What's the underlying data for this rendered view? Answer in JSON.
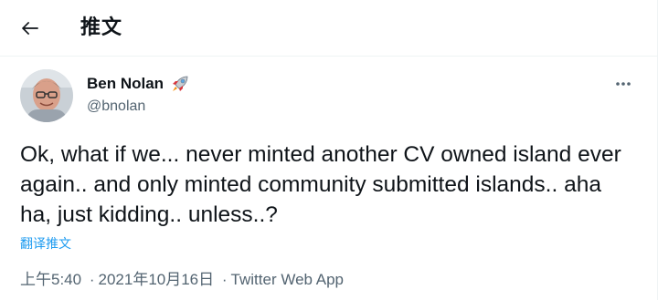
{
  "header": {
    "back_icon": "arrow-left-icon",
    "title": "推文"
  },
  "tweet": {
    "author": {
      "name": "Ben Nolan",
      "name_icon": "rocket-icon",
      "handle": "@bnolan"
    },
    "more_icon": "ellipsis-icon",
    "text": "Ok, what if we... never minted another CV owned island ever again.. and only minted community submitted islands.. aha ha, just kidding.. unless..?",
    "translate_label": "翻译推文",
    "time": "上午5:40",
    "date": "2021年10月16日",
    "separator": "·",
    "source": "Twitter Web App"
  },
  "colors": {
    "text": "#0f1419",
    "secondary": "#536471",
    "link": "#1d9bf0",
    "divider": "#eff3f4"
  }
}
